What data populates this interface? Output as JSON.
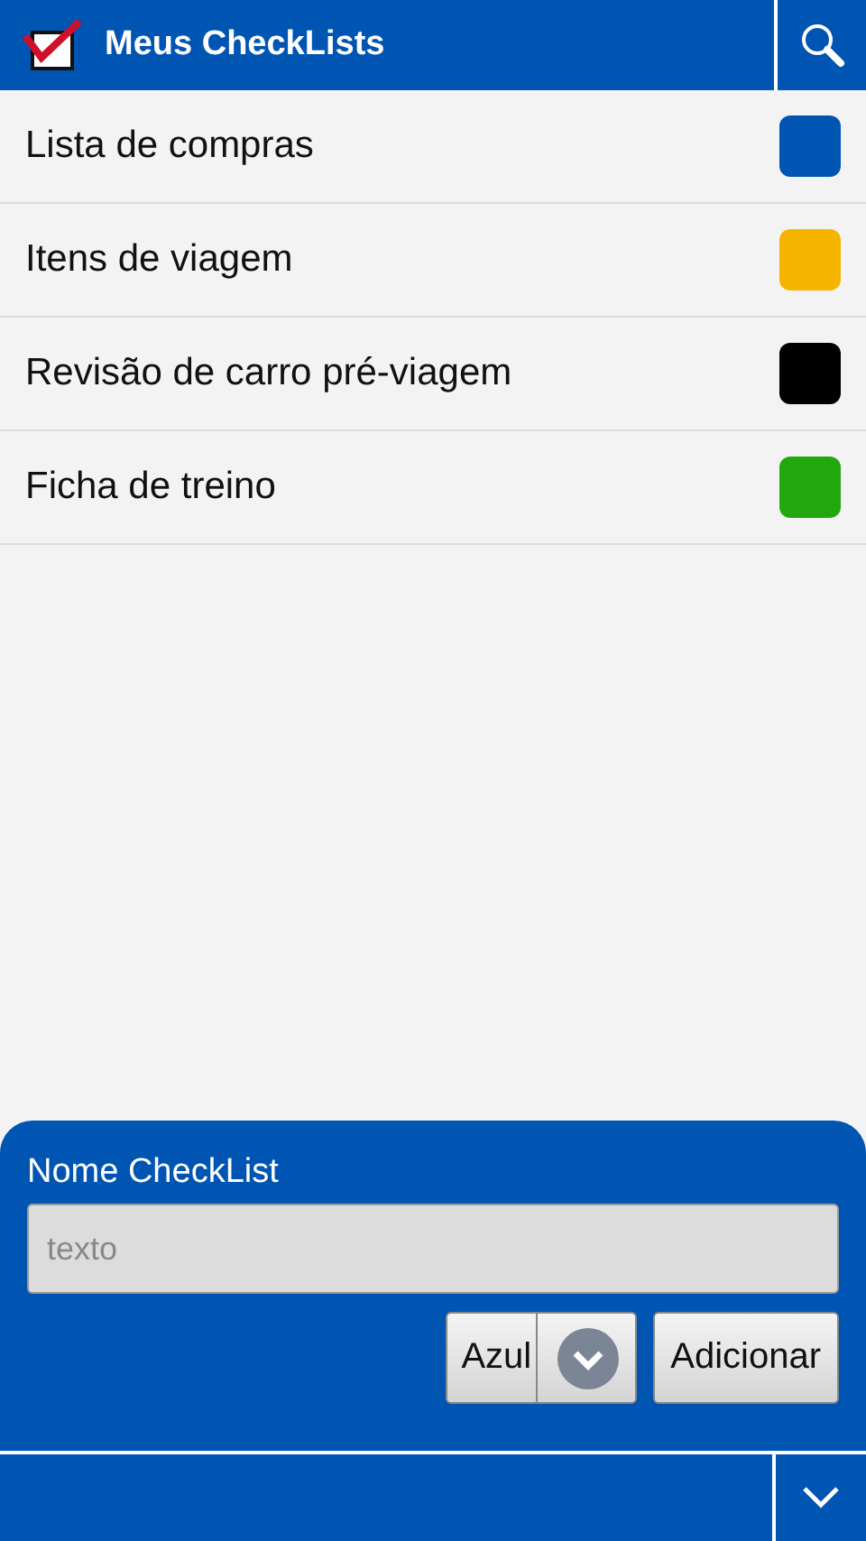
{
  "header": {
    "title": "Meus CheckLists"
  },
  "lists": [
    {
      "name": "Lista de compras",
      "color": "#0055b3"
    },
    {
      "name": "Itens de viagem",
      "color": "#f5b400"
    },
    {
      "name": "Revisão de carro pré-viagem",
      "color": "#000000"
    },
    {
      "name": "Ficha de treino",
      "color": "#22a80e"
    }
  ],
  "form": {
    "label": "Nome CheckList",
    "placeholder": "texto",
    "color_select": "Azul",
    "add_button": "Adicionar"
  }
}
